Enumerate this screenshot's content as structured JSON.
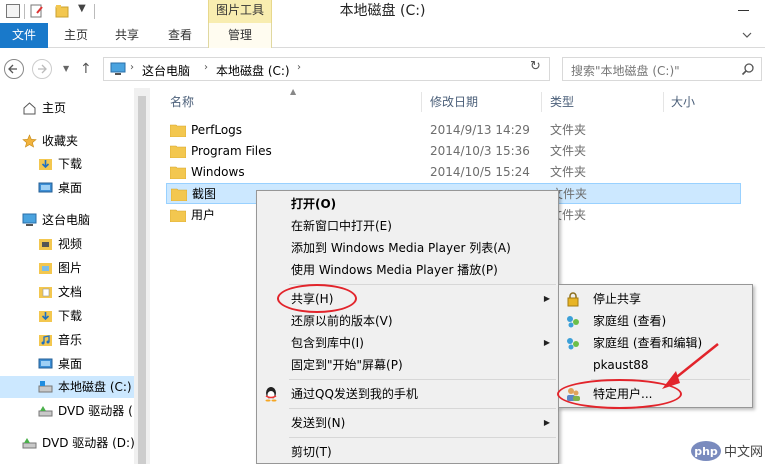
{
  "window": {
    "title": "本地磁盘 (C:)",
    "context_tab_title": "图片工具"
  },
  "ribbon": {
    "file_tab": "文件",
    "tabs": [
      "主页",
      "共享",
      "查看",
      "管理"
    ]
  },
  "address": {
    "crumbs": [
      "这台电脑",
      "本地磁盘 (C:)"
    ],
    "search_placeholder": "搜索\"本地磁盘 (C:)\""
  },
  "nav": {
    "items": [
      {
        "label": "主页",
        "icon": "home-icon"
      },
      {
        "label": "收藏夹",
        "icon": "star-icon"
      },
      {
        "label": "下载",
        "icon": "download-folder-icon"
      },
      {
        "label": "桌面",
        "icon": "desktop-icon"
      },
      {
        "label": "这台电脑",
        "icon": "computer-icon"
      },
      {
        "label": "视频",
        "icon": "video-folder-icon"
      },
      {
        "label": "图片",
        "icon": "pictures-folder-icon"
      },
      {
        "label": "文档",
        "icon": "documents-folder-icon"
      },
      {
        "label": "下载",
        "icon": "download-folder-icon"
      },
      {
        "label": "音乐",
        "icon": "music-folder-icon"
      },
      {
        "label": "桌面",
        "icon": "desktop-icon"
      },
      {
        "label": "本地磁盘 (C:)",
        "icon": "drive-icon"
      },
      {
        "label": "DVD 驱动器 (",
        "icon": "dvd-drive-icon"
      },
      {
        "label": "DVD 驱动器 (D:)",
        "icon": "dvd-drive-icon"
      }
    ]
  },
  "columns": {
    "name": "名称",
    "date": "修改日期",
    "type": "类型",
    "size": "大小"
  },
  "files": [
    {
      "name": "PerfLogs",
      "date": "2014/9/13 14:29",
      "type": "文件夹"
    },
    {
      "name": "Program Files",
      "date": "2014/10/3 15:36",
      "type": "文件夹"
    },
    {
      "name": "Windows",
      "date": "2014/10/5 15:24",
      "type": "文件夹"
    },
    {
      "name": "截图",
      "date": "",
      "type": "文件夹"
    },
    {
      "name": "用户",
      "date": "",
      "type": "文件夹"
    }
  ],
  "context_menu": {
    "items": [
      {
        "label": "打开(O)"
      },
      {
        "label": "在新窗口中打开(E)"
      },
      {
        "label": "添加到 Windows Media Player 列表(A)"
      },
      {
        "label": "使用 Windows Media Player 播放(P)"
      },
      {
        "label": "共享(H)",
        "submenu_arrow": "▶"
      },
      {
        "label": "还原以前的版本(V)"
      },
      {
        "label": "包含到库中(I)",
        "submenu_arrow": "▶"
      },
      {
        "label": "固定到\"开始\"屏幕(P)"
      },
      {
        "label": "通过QQ发送到我的手机"
      },
      {
        "label": "发送到(N)",
        "submenu_arrow": "▶"
      },
      {
        "label": "剪切(T)"
      }
    ]
  },
  "share_submenu": {
    "items": [
      {
        "label": "停止共享",
        "icon": "lock-icon"
      },
      {
        "label": "家庭组 (查看)",
        "icon": "homegroup-icon"
      },
      {
        "label": "家庭组 (查看和编辑)",
        "icon": "homegroup-icon"
      },
      {
        "label": "pkaust88",
        "icon": ""
      },
      {
        "label": "特定用户...",
        "icon": "users-icon"
      }
    ]
  },
  "watermark": {
    "text": "中文网",
    "logo": "php"
  },
  "colors": {
    "accent": "#1979ca",
    "selection": "#cce8ff",
    "annotation": "#e2242b"
  }
}
